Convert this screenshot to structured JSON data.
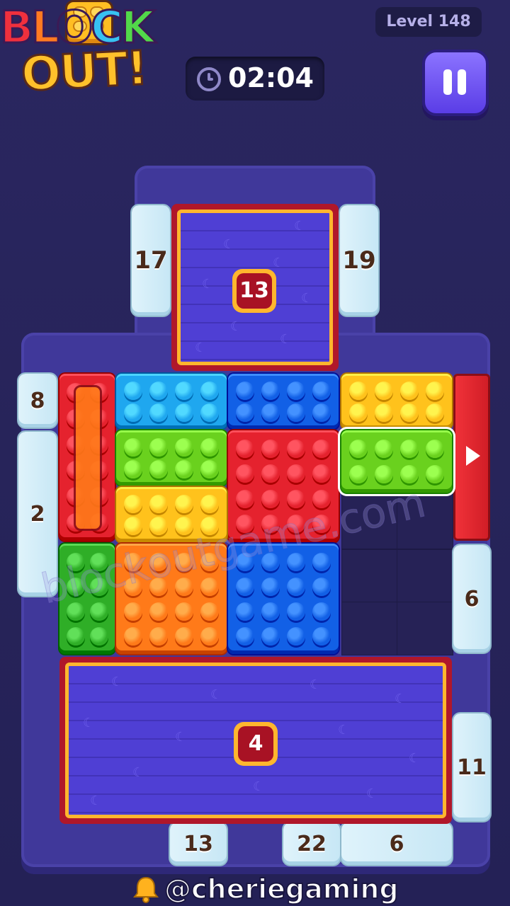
{
  "logo": {
    "line1": "BLOCK",
    "line2": "OUT!"
  },
  "header": {
    "timer": "02:04",
    "level": "Level 148"
  },
  "gates": [
    {
      "id": "gate-left-top",
      "value": "17"
    },
    {
      "id": "gate-right-top",
      "value": "19"
    },
    {
      "id": "gate-left-1",
      "value": "8"
    },
    {
      "id": "gate-left-2",
      "value": "2"
    },
    {
      "id": "gate-right-mid",
      "value": "6"
    },
    {
      "id": "gate-right-low",
      "value": "11"
    },
    {
      "id": "gate-bottom-1",
      "value": "13"
    },
    {
      "id": "gate-bottom-2",
      "value": "22"
    },
    {
      "id": "gate-bottom-3",
      "value": "6"
    }
  ],
  "frozen_blocks": [
    {
      "id": "frozen-top",
      "counter": "13"
    },
    {
      "id": "frozen-bottom",
      "counter": "4"
    }
  ],
  "colors": {
    "red": "#e5222e",
    "orange": "#ff7a19",
    "blue_light": "#1fa7ef",
    "blue": "#1260e6",
    "yellow": "#ffc21c",
    "green_light": "#6ad11e",
    "green": "#2fae27",
    "board": "#40389a",
    "gate_red": "#e0262f"
  },
  "watermark": "blockoutgame.com",
  "footer": {
    "handle": "@cheriegaming",
    "icon": "bell-icon"
  }
}
